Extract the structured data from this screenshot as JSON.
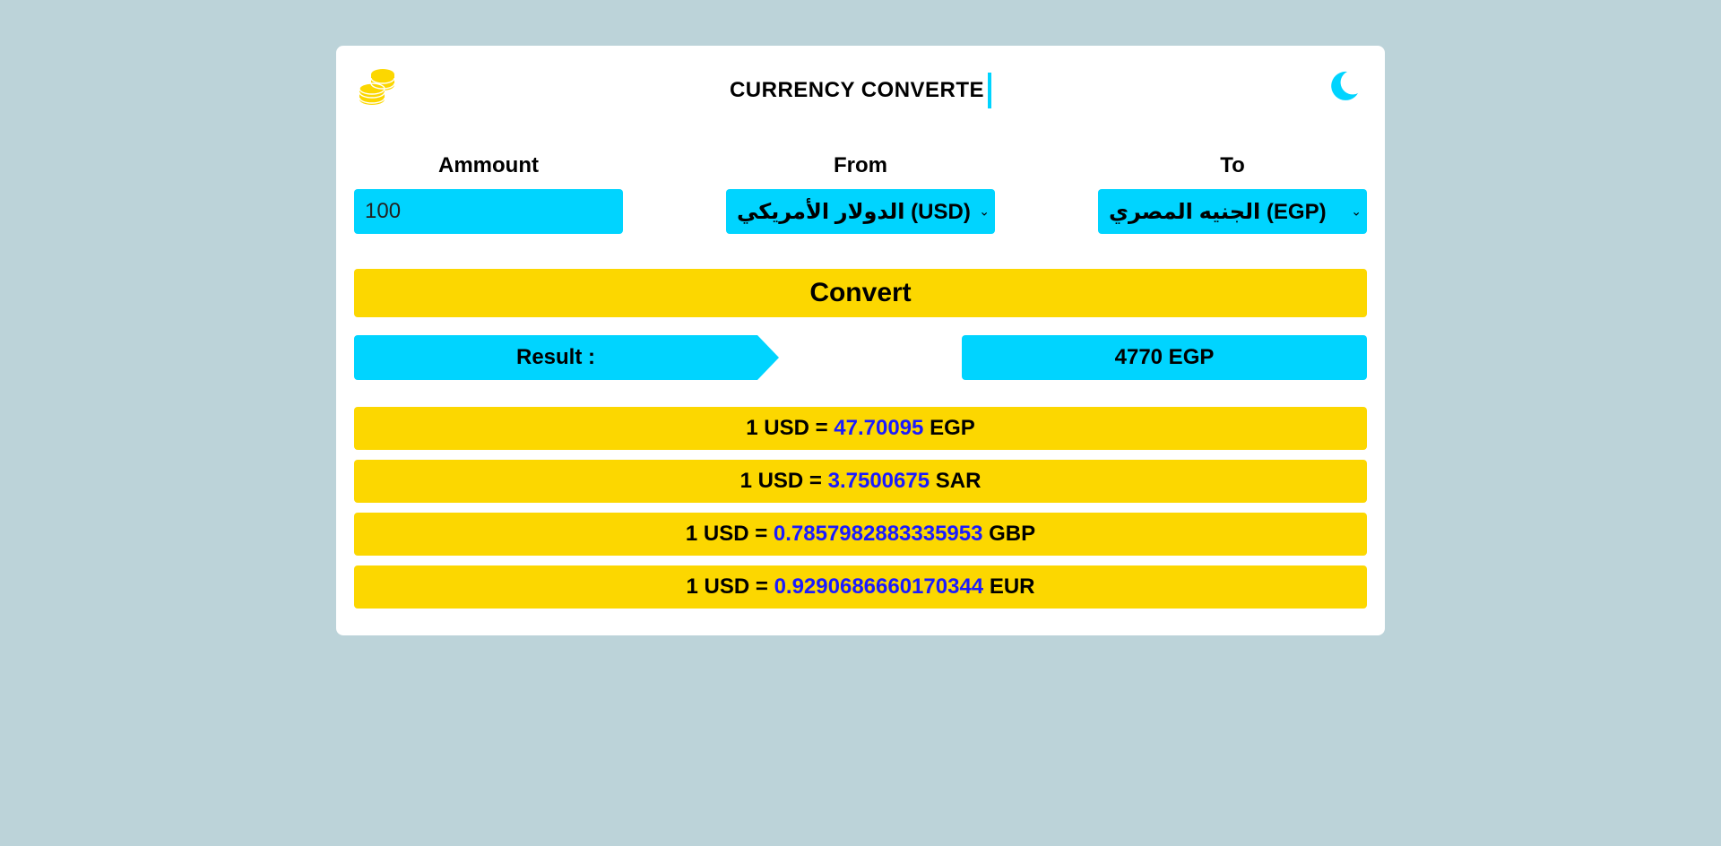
{
  "header": {
    "title": "CURRENCY CONVERTE",
    "logo_icon": "coins-icon",
    "theme_toggle_icon": "moon-icon"
  },
  "colors": {
    "background": "#bcd3d9",
    "card": "#ffffff",
    "cyan": "#00d4ff",
    "yellow": "#fcd700",
    "rate_number": "#1a1aff"
  },
  "form": {
    "amount": {
      "label": "Ammount",
      "value": "100"
    },
    "from": {
      "label": "From",
      "selected": "الدولار الأمريكي (USD)"
    },
    "to": {
      "label": "To",
      "selected": "الجنيه المصري (EGP)"
    }
  },
  "convert_button": {
    "label": "Convert"
  },
  "result": {
    "label": "Result :",
    "value": "4770 EGP"
  },
  "rates": [
    {
      "prefix": "1 USD =",
      "value": "47.70095",
      "currency": "EGP"
    },
    {
      "prefix": "1 USD =",
      "value": "3.7500675",
      "currency": "SAR"
    },
    {
      "prefix": "1 USD =",
      "value": "0.7857982883335953",
      "currency": "GBP"
    },
    {
      "prefix": "1 USD =",
      "value": "0.9290686660170344",
      "currency": "EUR"
    }
  ]
}
